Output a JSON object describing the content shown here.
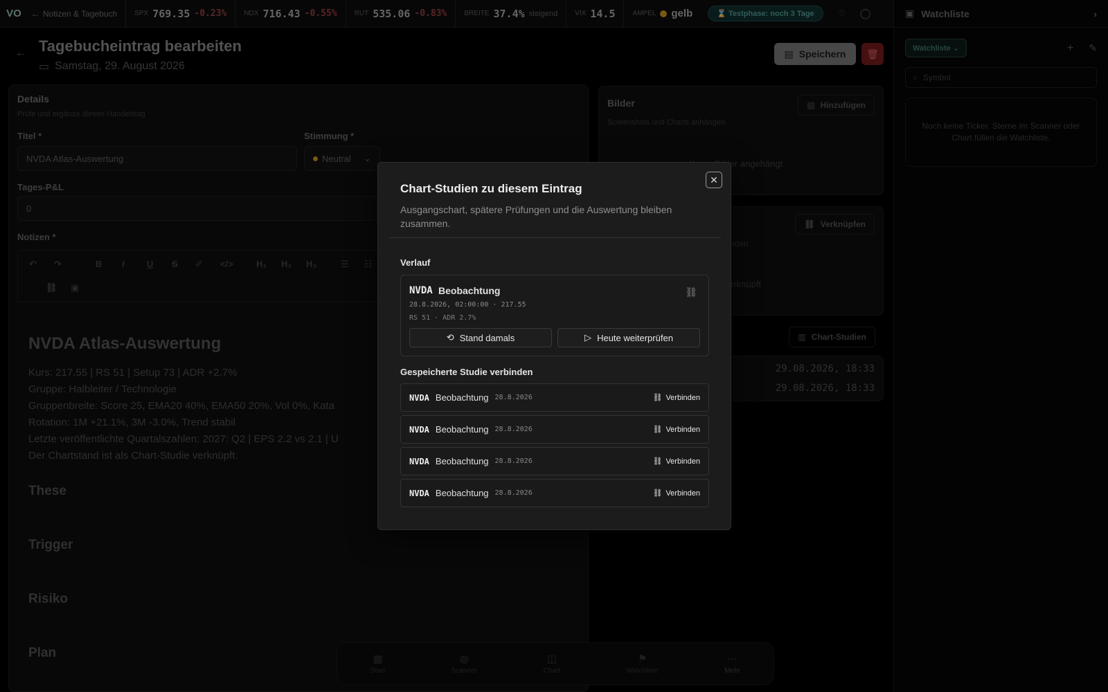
{
  "topbar": {
    "logo": "VO",
    "breadcrumb": "Notizen & Tagebuch",
    "tickers": [
      {
        "label": "SPX",
        "value": "769.35",
        "change": "-0.23%"
      },
      {
        "label": "NDX",
        "value": "716.43",
        "change": "-0.55%"
      },
      {
        "label": "RUT",
        "value": "535.06",
        "change": "-0.83%"
      }
    ],
    "breadth": {
      "label": "BREITE",
      "value": "37.4%",
      "sub": "steigend"
    },
    "vix": {
      "label": "VIX",
      "value": "14.5"
    },
    "ampel": {
      "label": "AMPEL",
      "value": "gelb",
      "color": "#b58a1c"
    },
    "trial": "Testphase: noch 3 Tage"
  },
  "watchlist": {
    "title": "Watchliste",
    "selector": "Watchliste",
    "search_placeholder": "Symbol",
    "empty": "Noch keine Ticker. Sterne im Scanner oder Chart füllen die Watchliste."
  },
  "page": {
    "title": "Tagebucheintrag bearbeiten",
    "date": "Samstag, 29. August 2026",
    "save": "Speichern"
  },
  "details": {
    "heading": "Details",
    "subheading": "Prüfe und ergänze diesen Handelstag",
    "title_label": "Titel *",
    "title_value": "NVDA Atlas-Auswertung",
    "mood_label": "Stimmung *",
    "mood_value": "Neutral",
    "pnl_label": "Tages-P&L",
    "pnl_value": "0",
    "notes_label": "Notizen *",
    "editor": {
      "h1": "NVDA Atlas-Auswertung",
      "lines": [
        "Kurs: 217.55 | RS 51 | Setup 73 | ADR +2.7%",
        "Gruppe: Halbleiter / Technologie",
        "Gruppenbreite: Score 25, EMA20 40%, EMA50 20%, Vol 0%, Kata",
        "Rotation: 1M +21.1%, 3M -3.0%, Trend stabil",
        "Letzte veröffentlichte Quartalszahlen: 2027: Q2 | EPS 2.2 vs 2.1 | U",
        "Der Chartstand ist als Chart-Studie verknüpft."
      ],
      "sections": [
        "These",
        "Trigger",
        "Risiko",
        "Plan"
      ]
    }
  },
  "images": {
    "heading": "Bilder",
    "sub": "Screenshots und Charts anhängen",
    "add": "Hinzufügen",
    "empty": "Keine Bilder angehängt"
  },
  "links": {
    "button": "Verknüpfen",
    "line1": "ag verbinden",
    "line2": "des verknüpft"
  },
  "studies": {
    "button": "Chart-Studien",
    "dates": [
      "29.08.2026, 18:33",
      "29.08.2026, 18:33"
    ]
  },
  "bottom_nav": [
    {
      "label": "Start"
    },
    {
      "label": "Scanner"
    },
    {
      "label": "Chart"
    },
    {
      "label": "Watchliste"
    },
    {
      "label": "Mehr"
    }
  ],
  "modal": {
    "title": "Chart-Studien zu diesem Eintrag",
    "description": "Ausgangschart, spätere Prüfungen und die Auswertung bleiben zusammen.",
    "history_label": "Verlauf",
    "history": {
      "symbol": "NVDA",
      "kind": "Beobachtung",
      "meta1": "28.8.2026, 02:00:00 · 217.55",
      "meta2": "RS 51 · ADR 2.7%",
      "btn_then": "Stand damals",
      "btn_today": "Heute weiterprüfen"
    },
    "saved_label": "Gespeicherte Studie verbinden",
    "saved": [
      {
        "symbol": "NVDA",
        "kind": "Beobachtung",
        "date": "28.8.2026",
        "action": "Verbinden"
      },
      {
        "symbol": "NVDA",
        "kind": "Beobachtung",
        "date": "28.8.2026",
        "action": "Verbinden"
      },
      {
        "symbol": "NVDA",
        "kind": "Beobachtung",
        "date": "28.8.2026",
        "action": "Verbinden"
      },
      {
        "symbol": "NVDA",
        "kind": "Beobachtung",
        "date": "28.8.2026",
        "action": "Verbinden"
      }
    ]
  }
}
